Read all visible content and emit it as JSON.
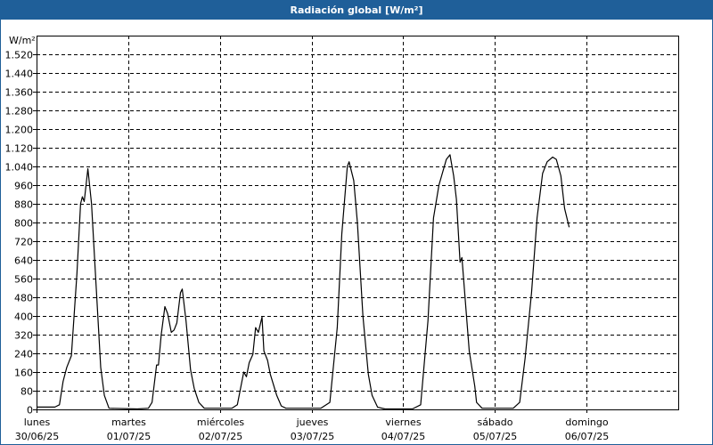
{
  "window": {
    "title": "Radiación global [W/m²]"
  },
  "chart_data": {
    "type": "line",
    "title": "Radiación global [W/m²]",
    "ylabel": "W/m²",
    "xlabel": "",
    "ylim": [
      0,
      1600
    ],
    "xlim": [
      0,
      7
    ],
    "grid": true,
    "yticks": [
      {
        "value": 0,
        "label": "0"
      },
      {
        "value": 80,
        "label": "80"
      },
      {
        "value": 160,
        "label": "160"
      },
      {
        "value": 240,
        "label": "240"
      },
      {
        "value": 320,
        "label": "320"
      },
      {
        "value": 400,
        "label": "400"
      },
      {
        "value": 480,
        "label": "480"
      },
      {
        "value": 560,
        "label": "560"
      },
      {
        "value": 640,
        "label": "640"
      },
      {
        "value": 720,
        "label": "720"
      },
      {
        "value": 800,
        "label": "800"
      },
      {
        "value": 880,
        "label": "880"
      },
      {
        "value": 960,
        "label": "960"
      },
      {
        "value": 1040,
        "label": "1.040"
      },
      {
        "value": 1120,
        "label": "1.120"
      },
      {
        "value": 1200,
        "label": "1.200"
      },
      {
        "value": 1280,
        "label": "1.280"
      },
      {
        "value": 1360,
        "label": "1.360"
      },
      {
        "value": 1440,
        "label": "1.440"
      },
      {
        "value": 1520,
        "label": "1.520"
      }
    ],
    "xticks": [
      {
        "value": 0,
        "day": "lunes",
        "date": "30/06/25"
      },
      {
        "value": 1,
        "day": "martes",
        "date": "01/07/25"
      },
      {
        "value": 2,
        "day": "miércoles",
        "date": "02/07/25"
      },
      {
        "value": 3,
        "day": "jueves",
        "date": "03/07/25"
      },
      {
        "value": 4,
        "day": "viernes",
        "date": "04/07/25"
      },
      {
        "value": 5,
        "day": "sábado",
        "date": "05/07/25"
      },
      {
        "value": 6,
        "day": "domingo",
        "date": "06/07/25"
      }
    ],
    "series": [
      {
        "color": "#000000",
        "points": [
          [
            0,
            10
          ],
          [
            0.2,
            10
          ],
          [
            0.25,
            20
          ],
          [
            0.29,
            120
          ],
          [
            0.33,
            180
          ],
          [
            0.38,
            230
          ],
          [
            0.44,
            580
          ],
          [
            0.48,
            880
          ],
          [
            0.5,
            910
          ],
          [
            0.52,
            890
          ],
          [
            0.56,
            1030
          ],
          [
            0.6,
            880
          ],
          [
            0.64,
            600
          ],
          [
            0.7,
            180
          ],
          [
            0.74,
            60
          ],
          [
            0.79,
            5
          ],
          [
            1.1,
            2
          ],
          [
            1.22,
            5
          ],
          [
            1.26,
            30
          ],
          [
            1.31,
            190
          ],
          [
            1.33,
            190
          ],
          [
            1.36,
            320
          ],
          [
            1.4,
            440
          ],
          [
            1.43,
            410
          ],
          [
            1.47,
            330
          ],
          [
            1.5,
            340
          ],
          [
            1.53,
            370
          ],
          [
            1.57,
            500
          ],
          [
            1.59,
            515
          ],
          [
            1.63,
            380
          ],
          [
            1.68,
            170
          ],
          [
            1.72,
            90
          ],
          [
            1.77,
            30
          ],
          [
            1.83,
            5
          ],
          [
            2.13,
            5
          ],
          [
            2.19,
            20
          ],
          [
            2.23,
            100
          ],
          [
            2.26,
            160
          ],
          [
            2.29,
            140
          ],
          [
            2.32,
            200
          ],
          [
            2.36,
            235
          ],
          [
            2.39,
            350
          ],
          [
            2.42,
            330
          ],
          [
            2.46,
            395
          ],
          [
            2.48,
            250
          ],
          [
            2.52,
            210
          ],
          [
            2.55,
            150
          ],
          [
            2.62,
            60
          ],
          [
            2.67,
            15
          ],
          [
            2.72,
            5
          ],
          [
            3.1,
            5
          ],
          [
            3.2,
            30
          ],
          [
            3.28,
            350
          ],
          [
            3.33,
            750
          ],
          [
            3.39,
            1040
          ],
          [
            3.41,
            1060
          ],
          [
            3.46,
            980
          ],
          [
            3.5,
            800
          ],
          [
            3.56,
            400
          ],
          [
            3.62,
            150
          ],
          [
            3.66,
            60
          ],
          [
            3.72,
            10
          ],
          [
            3.8,
            2
          ],
          [
            4.1,
            2
          ],
          [
            4.19,
            20
          ],
          [
            4.27,
            380
          ],
          [
            4.33,
            820
          ],
          [
            4.39,
            960
          ],
          [
            4.47,
            1070
          ],
          [
            4.51,
            1090
          ],
          [
            4.55,
            1000
          ],
          [
            4.58,
            900
          ],
          [
            4.62,
            630
          ],
          [
            4.64,
            650
          ],
          [
            4.68,
            450
          ],
          [
            4.72,
            250
          ],
          [
            4.78,
            100
          ],
          [
            4.8,
            30
          ],
          [
            4.86,
            5
          ],
          [
            5.2,
            5
          ],
          [
            5.27,
            30
          ],
          [
            5.33,
            220
          ],
          [
            5.4,
            500
          ],
          [
            5.46,
            820
          ],
          [
            5.52,
            1010
          ],
          [
            5.57,
            1060
          ],
          [
            5.63,
            1080
          ],
          [
            5.67,
            1070
          ],
          [
            5.72,
            1000
          ],
          [
            5.76,
            860
          ],
          [
            5.81,
            780
          ]
        ]
      }
    ]
  }
}
